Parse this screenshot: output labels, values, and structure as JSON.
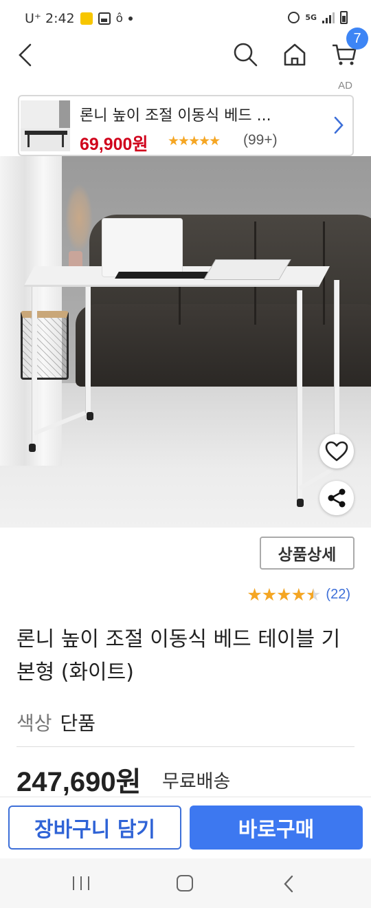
{
  "status_bar": {
    "carrier_time": "U⁺ 2:42",
    "network": "5G"
  },
  "app_bar": {
    "cart_count": "7"
  },
  "ad": {
    "label": "AD",
    "title": "론니 높이 조절 이동식 베드 ...",
    "price": "69,900원",
    "stars": "★★★★★",
    "review_count": "(99+)"
  },
  "product": {
    "detail_button": "상품상세",
    "rating": {
      "stars": "★★★★★",
      "value": 4.5,
      "count": "(22)"
    },
    "title": "론니 높이 조절 이동식 베드 테이블 기본형 (화이트)",
    "option": {
      "key": "색상",
      "value": "단품"
    },
    "price": "247,690원",
    "shipping": "무료배송"
  },
  "actions": {
    "add_to_cart": "장바구니 담기",
    "buy_now": "바로구매"
  },
  "colors": {
    "accent": "#3d78f0",
    "price_red": "#d0021b",
    "star": "#f5a623",
    "link_blue": "#3d6fd8"
  },
  "icons": [
    "back-icon",
    "search-icon",
    "home-icon",
    "cart-icon",
    "chevron-right-icon",
    "heart-icon",
    "share-icon",
    "recent-apps-icon",
    "home-nav-icon",
    "back-nav-icon"
  ]
}
